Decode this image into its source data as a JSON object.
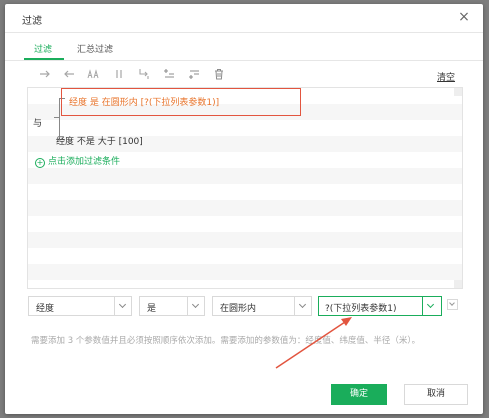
{
  "dialog": {
    "title": "过滤",
    "close_glyph": "×"
  },
  "tabs": [
    {
      "label": "过滤",
      "active": true
    },
    {
      "label": "汇总过滤",
      "active": false
    }
  ],
  "toolbar": {
    "icons": [
      "move-right-icon",
      "move-left-icon",
      "and-icon",
      "or-icon",
      "swap-icon",
      "insert-above-icon",
      "insert-below-icon",
      "delete-icon"
    ],
    "clear_label": "清空"
  },
  "filter_tree": {
    "join_label": "与",
    "conditions": [
      {
        "text": "经度 是 在圆形内 [?(下拉列表参数1)]",
        "selected": true
      },
      {
        "text": "经度 不是 大于 [100]",
        "selected": false
      }
    ],
    "add_label": "点击添加过滤条件"
  },
  "editor": {
    "field": "经度",
    "operator": "是",
    "condition": "在圆形内",
    "value": "?(下拉列表参数1)"
  },
  "hint": "需要添加 3 个参数值并且必须按照顺序依次添加。需要添加的参数值为：经度值、纬度值、半径（米）。",
  "buttons": {
    "ok": "确定",
    "cancel": "取消"
  },
  "colors": {
    "accent": "#1aad5b",
    "selected_text": "#e8732a",
    "annotation": "#e2553f"
  }
}
